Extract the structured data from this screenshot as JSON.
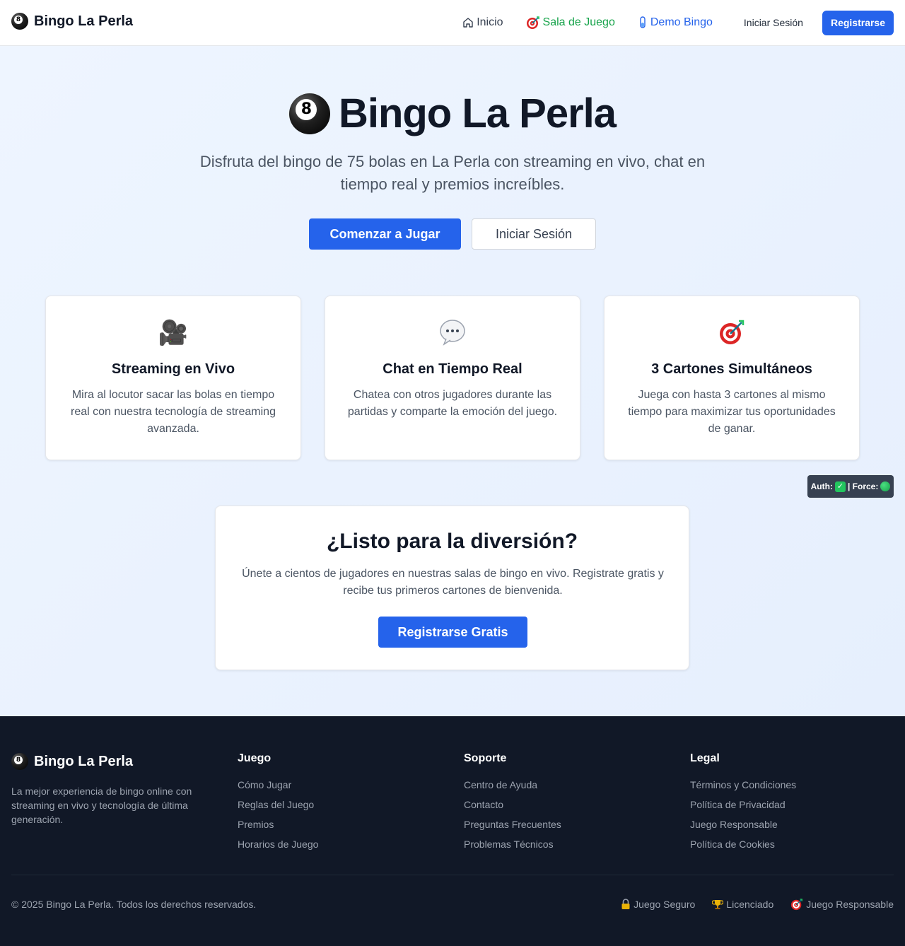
{
  "nav": {
    "brand": "Bingo La Perla",
    "brand_icon": "8-ball-icon",
    "links": [
      {
        "label": "Inicio",
        "icon": "home-icon"
      },
      {
        "label": "Sala de Juego",
        "icon": "target-icon"
      },
      {
        "label": "Demo Bingo",
        "icon": "test-tube-icon"
      }
    ],
    "login": "Iniciar Sesión",
    "register": "Registrarse"
  },
  "hero": {
    "title": "Bingo La Perla",
    "subtitle": "Disfruta del bingo de 75 bolas en La Perla con streaming en vivo, chat en tiempo real y premios increíbles.",
    "primary_button": "Comenzar a Jugar",
    "secondary_button": "Iniciar Sesión"
  },
  "features": [
    {
      "icon": "movie-camera-icon",
      "title": "Streaming en Vivo",
      "desc": "Mira al locutor sacar las bolas en tiempo real con nuestra tecnología de streaming avanzada."
    },
    {
      "icon": "speech-bubble-icon",
      "title": "Chat en Tiempo Real",
      "desc": "Chatea con otros jugadores durante las partidas y comparte la emoción del juego."
    },
    {
      "icon": "target-icon",
      "title": "3 Cartones Simultáneos",
      "desc": "Juega con hasta 3 cartones al mismo tiempo para maximizar tus oportunidades de ganar."
    }
  ],
  "status": {
    "auth_label": "Auth:",
    "force_label": "| Force:"
  },
  "cta": {
    "title": "¿Listo para la diversión?",
    "desc": "Únete a cientos de jugadores en nuestras salas de bingo en vivo. Registrate gratis y recibe tus primeros cartones de bienvenida.",
    "button": "Registrarse Gratis"
  },
  "footer": {
    "brand": "Bingo La Perla",
    "tagline": "La mejor experiencia de bingo online con streaming en vivo y tecnología de última generación.",
    "columns": [
      {
        "title": "Juego",
        "links": [
          "Cómo Jugar",
          "Reglas del Juego",
          "Premios",
          "Horarios de Juego"
        ]
      },
      {
        "title": "Soporte",
        "links": [
          "Centro de Ayuda",
          "Contacto",
          "Preguntas Frecuentes",
          "Problemas Técnicos"
        ]
      },
      {
        "title": "Legal",
        "links": [
          "Términos y Condiciones",
          "Política de Privacidad",
          "Juego Responsable",
          "Política de Cookies"
        ]
      }
    ],
    "copyright": "© 2025 Bingo La Perla. Todos los derechos reservados.",
    "badges": [
      {
        "icon": "lock-icon",
        "label": "Juego Seguro"
      },
      {
        "icon": "trophy-icon",
        "label": "Licenciado"
      },
      {
        "icon": "target-icon",
        "label": "Juego Responsable"
      }
    ]
  },
  "colors": {
    "accent": "#2563eb",
    "sala_link": "#16a34a",
    "footer_bg": "#111827"
  }
}
